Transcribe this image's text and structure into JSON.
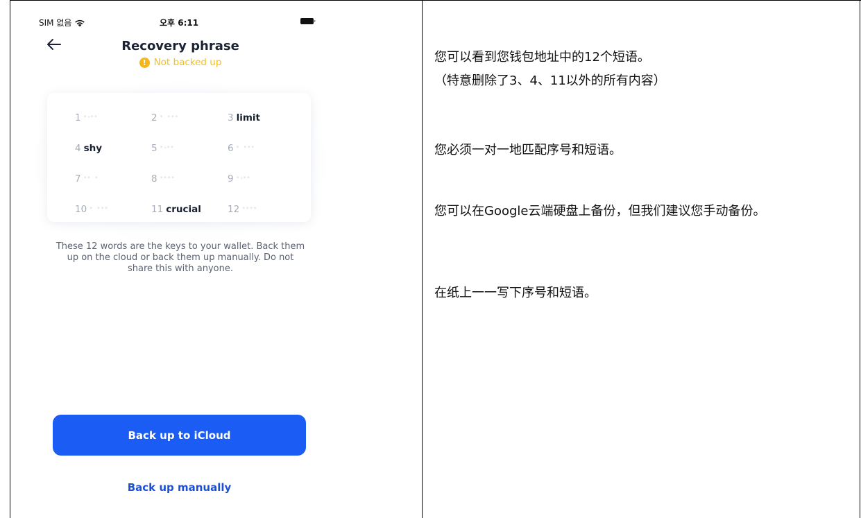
{
  "status_bar": {
    "carrier": "SIM 없음",
    "time": "오후 6:11",
    "icons": [
      "wifi-icon",
      "battery-icon"
    ]
  },
  "header": {
    "back_icon": "arrow-left-icon",
    "title": "Recovery phrase",
    "status": "Not backed up",
    "status_icon": "warning-icon",
    "status_color": "#f4c01b"
  },
  "phrase": {
    "words": [
      {
        "num": "1",
        "word": "",
        "hidden": true
      },
      {
        "num": "2",
        "word": "",
        "hidden": true
      },
      {
        "num": "3",
        "word": "limit",
        "hidden": false
      },
      {
        "num": "4",
        "word": "shy",
        "hidden": false
      },
      {
        "num": "5",
        "word": "",
        "hidden": true
      },
      {
        "num": "6",
        "word": "",
        "hidden": true
      },
      {
        "num": "7",
        "word": "",
        "hidden": true
      },
      {
        "num": "8",
        "word": "",
        "hidden": true
      },
      {
        "num": "9",
        "word": "",
        "hidden": true
      },
      {
        "num": "10",
        "word": "",
        "hidden": true
      },
      {
        "num": "11",
        "word": "crucial",
        "hidden": false
      },
      {
        "num": "12",
        "word": "",
        "hidden": true
      }
    ]
  },
  "description": "These 12 words are the keys to your wallet. Back them up on the cloud or back them up manually. Do not share this with anyone.",
  "actions": {
    "icloud_label": "Back up to iCloud",
    "manual_label": "Back up manually",
    "accent_color": "#1a5cf4"
  },
  "notes": {
    "n1": "您可以看到您钱包地址中的12个短语。",
    "n2": "（特意删除了3、4、11以外的所有内容）",
    "n3": "您必须一对一地匹配序号和短语。",
    "n4": "您可以在Google云端硬盘上备份，但我们建议您手动备份。",
    "n5": "在纸上一一写下序号和短语。"
  }
}
